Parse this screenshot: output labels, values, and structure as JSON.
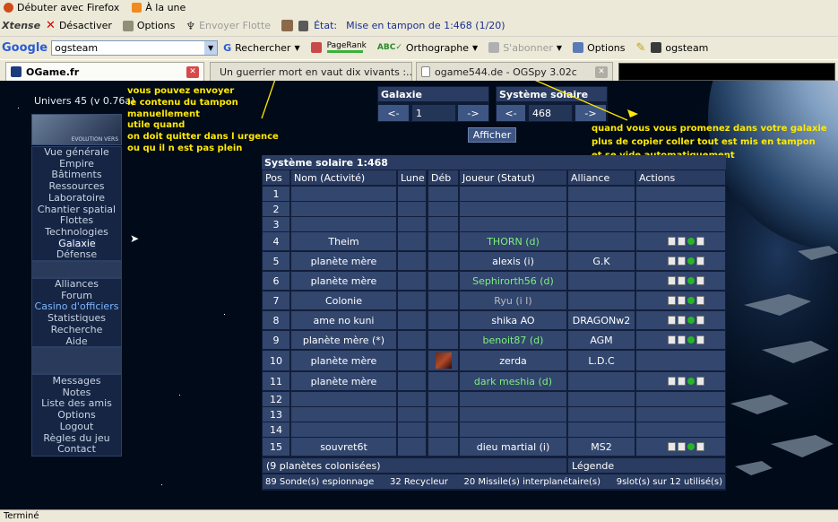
{
  "browser": {
    "bookmarks": [
      "Débuter avec Firefox",
      "À la une"
    ],
    "xtense": {
      "logo": "Xtense",
      "deactivate": "Désactiver",
      "options": "Options",
      "send_fleet": "Envoyer Flotte",
      "state_label": "État:",
      "state_value": "Mise en tampon de 1:468 (1/20)"
    },
    "google": {
      "logo": "Google",
      "search_value": "ogsteam",
      "search": "Rechercher",
      "pagerank": "PageRank",
      "spell": "Orthographe",
      "subscribe": "S'abonner",
      "options": "Options",
      "user": "ogsteam"
    },
    "tabs": [
      {
        "label": "OGame.fr"
      },
      {
        "label": "Un guerrier mort en vaut dix vivants :..."
      },
      {
        "label": "ogame544.de - OGSpy 3.02c"
      }
    ],
    "status_text": "Terminé"
  },
  "game": {
    "universe": "Univers 45 (v 0.76a)",
    "logo_text": "EVOLUTION VERS",
    "menu1": [
      "Vue générale",
      "Empire",
      "Bâtiments",
      "Ressources",
      "Laboratoire",
      "Chantier spatial",
      "Flottes",
      "Technologies",
      "Galaxie",
      "Défense"
    ],
    "menu2": [
      "Alliances",
      "Forum",
      "Casino d'officiers",
      "Statistiques",
      "Recherche",
      "Aide"
    ],
    "menu3": [
      "Messages",
      "Notes",
      "Liste des amis",
      "Options",
      "Logout",
      "Règles du jeu",
      "Contact"
    ],
    "nav": {
      "galaxy_label": "Galaxie",
      "system_label": "Système solaire",
      "galaxy_value": "1",
      "system_value": "468",
      "prev": "<-",
      "next": "->",
      "show": "Afficher"
    },
    "table": {
      "title": "Système solaire 1:468",
      "headers": [
        "Pos",
        "Nom (Activité)",
        "Lune",
        "Déb",
        "Joueur (Statut)",
        "Alliance",
        "Actions"
      ],
      "rows": [
        {
          "pos": "1",
          "name": "",
          "player": "",
          "alliance": "",
          "green": false,
          "actions": false,
          "deb": false
        },
        {
          "pos": "2",
          "name": "",
          "player": "",
          "alliance": "",
          "green": false,
          "actions": false,
          "deb": false
        },
        {
          "pos": "3",
          "name": "",
          "player": "",
          "alliance": "",
          "green": false,
          "actions": false,
          "deb": false
        },
        {
          "pos": "4",
          "name": "Theim",
          "player": "THORN (d)",
          "alliance": "",
          "green": true,
          "actions": true,
          "deb": false
        },
        {
          "pos": "5",
          "name": "planète mère",
          "player": "alexis (i)",
          "alliance": "G.K",
          "green": false,
          "actions": true,
          "deb": false
        },
        {
          "pos": "6",
          "name": "planète mère",
          "player": "Sephirorth56 (d)",
          "alliance": "",
          "green": true,
          "actions": true,
          "deb": false
        },
        {
          "pos": "7",
          "name": "Colonie",
          "player": "Ryu (i I)",
          "alliance": "",
          "green": false,
          "gray": true,
          "actions": true,
          "deb": false
        },
        {
          "pos": "8",
          "name": "ame no kuni",
          "player": "shika AO",
          "alliance": "DRAGONw2",
          "green": false,
          "actions": true,
          "deb": false
        },
        {
          "pos": "9",
          "name": "planète mère (*)",
          "player": "benoit87 (d)",
          "alliance": "AGM",
          "green": true,
          "actions": true,
          "deb": false
        },
        {
          "pos": "10",
          "name": "planète mère",
          "player": "zerda",
          "alliance": "L.D.C",
          "green": false,
          "actions": false,
          "deb": true
        },
        {
          "pos": "11",
          "name": "planète mère",
          "player": "dark meshia (d)",
          "alliance": "",
          "green": true,
          "actions": true,
          "deb": false
        },
        {
          "pos": "12",
          "name": "",
          "player": "",
          "alliance": "",
          "green": false,
          "actions": false,
          "deb": false
        },
        {
          "pos": "13",
          "name": "",
          "player": "",
          "alliance": "",
          "green": false,
          "actions": false,
          "deb": false
        },
        {
          "pos": "14",
          "name": "",
          "player": "",
          "alliance": "",
          "green": false,
          "actions": false,
          "deb": false
        },
        {
          "pos": "15",
          "name": "souvret6t",
          "player": "dieu martial (i)",
          "alliance": "MS2",
          "green": false,
          "actions": true,
          "deb": false
        }
      ],
      "footer_colonized": "(9 planètes colonisées)",
      "footer_legend": "Légende",
      "bottom": [
        "89 Sonde(s) espionnage",
        "32 Recycleur",
        "20 Missile(s) interplanétaire(s)",
        "9slot(s) sur 12 utilisé(s)"
      ]
    }
  },
  "annotations": {
    "left": [
      "vous pouvez envoyer",
      "le contenu du tampon",
      "manuellement",
      "utile quand",
      "on doit quitter dans l urgence",
      "ou qu il n est pas plein"
    ],
    "right": [
      "quand vous vous promenez dans votre galaxie",
      "plus de copier coller tout est mis en tampon",
      "et se vide automatiquement"
    ]
  },
  "colors": {
    "annotation": "#ffea00",
    "green_player": "#7df07d",
    "panel": "#32466e",
    "space": "#000a18"
  }
}
